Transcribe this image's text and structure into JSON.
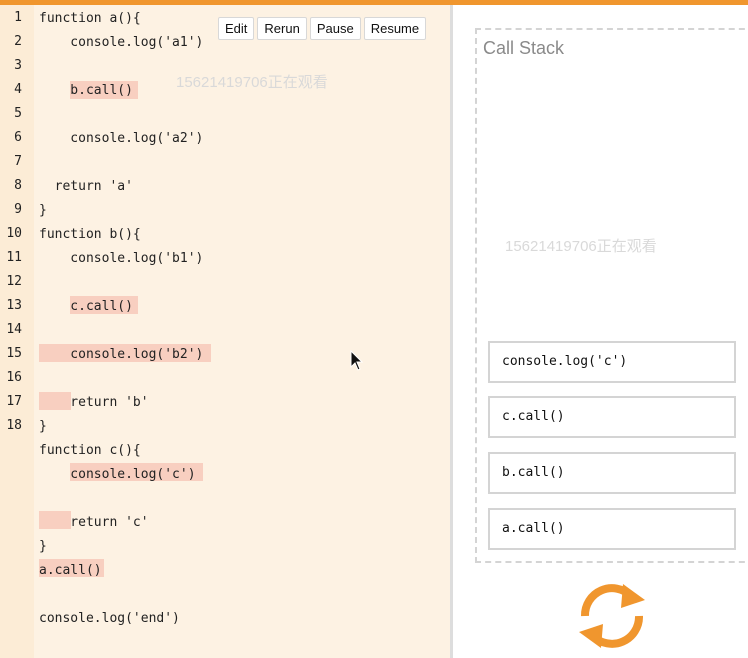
{
  "window": {
    "accent_color": "#f0962e",
    "highlight_color": "#f8cfc0"
  },
  "toolbar": {
    "edit_label": "Edit",
    "rerun_label": "Rerun",
    "pause_label": "Pause",
    "resume_label": "Resume"
  },
  "editor": {
    "line_numbers": [
      "1",
      "2",
      "3",
      "4",
      "5",
      "6",
      "7",
      "8",
      "9",
      "10",
      "11",
      "12",
      "13",
      "14",
      "15",
      "16",
      "17",
      "18"
    ],
    "lines": [
      "function a(){",
      "    console.log('a1')",
      "",
      "    b.call()",
      "",
      "    console.log('a2')",
      "",
      "  return 'a'",
      "}",
      "function b(){",
      "    console.log('b1')",
      "",
      "    c.call()",
      "",
      "    console.log('b2')",
      "",
      "    return 'b'",
      "}",
      "function c(){",
      "    console.log('c')",
      "",
      "    return 'c'",
      "}",
      "a.call()",
      "",
      "console.log('end')"
    ]
  },
  "call_stack": {
    "title": "Call Stack",
    "frames": [
      "console.log('c')",
      "c.call()",
      "b.call()",
      "a.call()"
    ]
  },
  "watermark": "15621419706正在观看",
  "icons": {
    "cursor": "mouse-pointer-icon",
    "loop": "event-loop-icon"
  }
}
